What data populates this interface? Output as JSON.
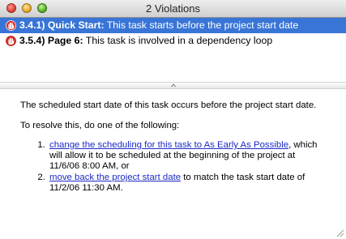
{
  "window": {
    "title": "2 Violations"
  },
  "violations": [
    {
      "id": "3.4.1) Quick Start:",
      "message": " This task starts before the project start date",
      "selected": true
    },
    {
      "id": "3.5.4) Page 6:",
      "message": " This task is involved in a dependency loop",
      "selected": false
    }
  ],
  "detail": {
    "description": "The scheduled start date of this task occurs before the project start date.",
    "resolve_intro": "To resolve this, do one of the following:",
    "options": [
      {
        "link": "change the scheduling for this task to As Early As Possible",
        "text": ", which will allow it to be scheduled at the beginning of the project at 11/6/06 8:00 AM, or"
      },
      {
        "link": "move back the project start date",
        "text": " to match the task start date of 11/2/06 11:30 AM."
      }
    ]
  },
  "colors": {
    "selection": "#3875d7",
    "link": "#1c2ac8",
    "violation_icon": "#d9302a"
  },
  "icons": {
    "violation": "warning-hand-icon",
    "splitter": "chevron-up-icon",
    "resize": "resize-grip-icon"
  }
}
